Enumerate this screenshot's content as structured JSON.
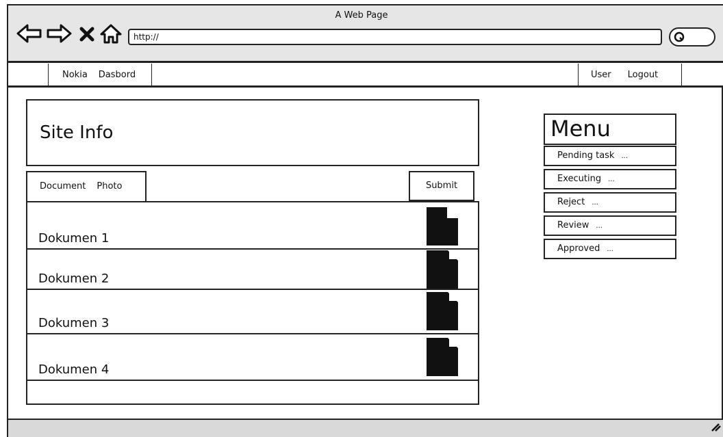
{
  "browser": {
    "title": "A Web Page",
    "url": "http://",
    "icons": [
      "back-arrow-icon",
      "forward-arrow-icon",
      "close-icon",
      "home-icon",
      "search-icon"
    ]
  },
  "topbar": {
    "left": [
      "Nokia",
      "Dasbord"
    ],
    "right": [
      "User",
      "Logout"
    ]
  },
  "main": {
    "heading": "Site Info",
    "tabs": [
      "Document",
      "Photo"
    ],
    "submit_label": "Submit",
    "documents": [
      "Dokumen 1",
      "Dokumen 2",
      "Dokumen 3",
      "Dokumen 4"
    ],
    "document_icon": "file-icon"
  },
  "menu": {
    "title": "Menu",
    "items": [
      {
        "label": "Pending task",
        "more": "..."
      },
      {
        "label": "Executing",
        "more": "..."
      },
      {
        "label": "Reject",
        "more": "..."
      },
      {
        "label": "Review",
        "more": "..."
      },
      {
        "label": "Approved",
        "more": "..."
      }
    ]
  }
}
